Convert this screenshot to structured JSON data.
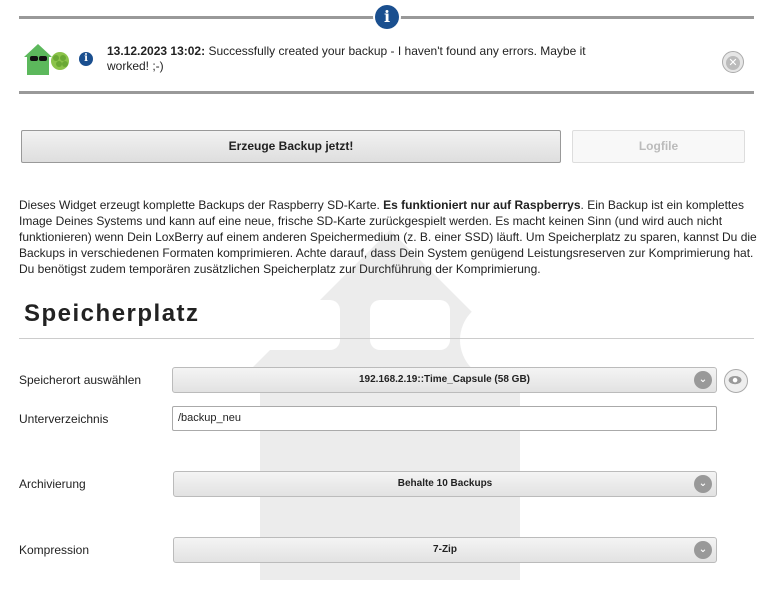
{
  "notification": {
    "timestamp": "13.12.2023 13:02:",
    "message": "Successfully created your backup - I haven't found any errors. Maybe it worked! ;-)",
    "info_icon": "info-icon",
    "close_icon": "close-icon",
    "logo_icon": "loxberry-logo"
  },
  "actions": {
    "create_backup_label": "Erzeuge Backup jetzt!",
    "logfile_label": "Logfile"
  },
  "description": {
    "part1": "Dieses Widget erzeugt komplette Backups der Raspberry SD-Karte. ",
    "bold": "Es funktioniert nur auf Raspberrys",
    "part2": ". Ein Backup ist ein komplettes Image Deines Systems und kann auf eine neue, frische SD-Karte zurückgespielt werden. Es macht keinen Sinn (und wird auch nicht funktionieren) wenn Dein LoxBerry auf einem anderen Speichermedium (z. B. einer SSD) läuft. Um Speicherplatz zu sparen, kannst Du die Backups in verschiedenen Formaten komprimieren. Achte darauf, dass Dein System genügend Leistungsreserven zur Komprimierung hat. Du benötigst zudem temporären zusätzlichen Speicherplatz zur Durchführung der Komprimierung."
  },
  "section": {
    "title": "Speicherplatz"
  },
  "form": {
    "location_label": "Speicherort auswählen",
    "location_value": "192.168.2.19::Time_Capsule (58 GB)",
    "subdir_label": "Unterverzeichnis",
    "subdir_value": "/backup_neu",
    "archive_label": "Archivierung",
    "archive_value": "Behalte 10 Backups",
    "compression_label": "Kompression",
    "compression_value": "7-Zip"
  },
  "colors": {
    "accent_blue": "#1a4f8f",
    "logo_green": "#4caf50"
  }
}
